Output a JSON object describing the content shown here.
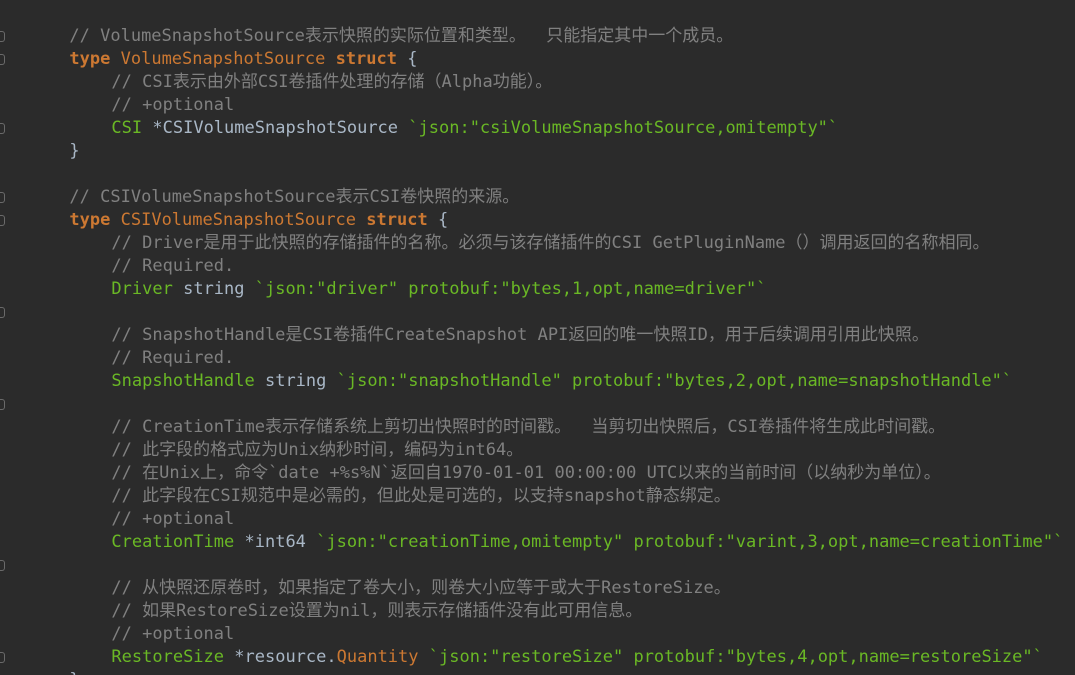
{
  "code": {
    "l01": "// VolumeSnapshotSource表示快照的实际位置和类型。  只能指定其中一个成员。",
    "l02_kw": "type",
    "l02_name": "VolumeSnapshotSource",
    "l02_struct": "struct",
    "l02_brace": "{",
    "l03": "// CSI表示由外部CSI卷插件处理的存储（Alpha功能）。",
    "l04": "// +optional",
    "l05_field": "CSI",
    "l05_type": "*CSIVolumeSnapshotSource",
    "l05_tag": "`json:\"csiVolumeSnapshotSource,omitempty\"`",
    "l06": "}",
    "l08": "// CSIVolumeSnapshotSource表示CSI卷快照的来源。",
    "l09_kw": "type",
    "l09_name": "CSIVolumeSnapshotSource",
    "l09_struct": "struct",
    "l09_brace": "{",
    "l10": "// Driver是用于此快照的存储插件的名称。必须与该存储插件的CSI GetPluginName（）调用返回的名称相同。",
    "l11": "// Required.",
    "l12_field": "Driver",
    "l12_type": "string",
    "l12_tag": "`json:\"driver\" protobuf:\"bytes,1,opt,name=driver\"`",
    "l14": "// SnapshotHandle是CSI卷插件CreateSnapshot API返回的唯一快照ID，用于后续调用引用此快照。",
    "l15": "// Required.",
    "l16_field": "SnapshotHandle",
    "l16_type": "string",
    "l16_tag": "`json:\"snapshotHandle\" protobuf:\"bytes,2,opt,name=snapshotHandle\"`",
    "l18": "// CreationTime表示存储系统上剪切出快照时的时间戳。  当剪切出快照后，CSI卷插件将生成此时间戳。",
    "l19": "// 此字段的格式应为Unix纳秒时间，编码为int64。",
    "l20": "// 在Unix上，命令`date +%s%N`返回自1970-01-01 00:00:00 UTC以来的当前时间（以纳秒为单位）。",
    "l21": "// 此字段在CSI规范中是必需的，但此处是可选的，以支持snapshot静态绑定。",
    "l22": "// +optional",
    "l23_field": "CreationTime",
    "l23_type": "*int64",
    "l23_tag": "`json:\"creationTime,omitempty\" protobuf:\"varint,3,opt,name=creationTime\"`",
    "l25": "// 从快照还原卷时，如果指定了卷大小，则卷大小应等于或大于RestoreSize。",
    "l26": "// 如果RestoreSize设置为nil，则表示存储插件没有此可用信息。",
    "l27": "// +optional",
    "l28_field": "RestoreSize",
    "l28_type_ptr": "*resource.",
    "l28_type_name": "Quantity",
    "l28_tag": "`json:\"restoreSize\" protobuf:\"bytes,4,opt,name=restoreSize\"`",
    "l29": "}"
  },
  "colors": {
    "background": "#2b2b2b",
    "keyword": "#cc7832",
    "field": "#6ab825",
    "comment": "#808080",
    "string": "#6ab825",
    "text": "#a9b7c6"
  }
}
